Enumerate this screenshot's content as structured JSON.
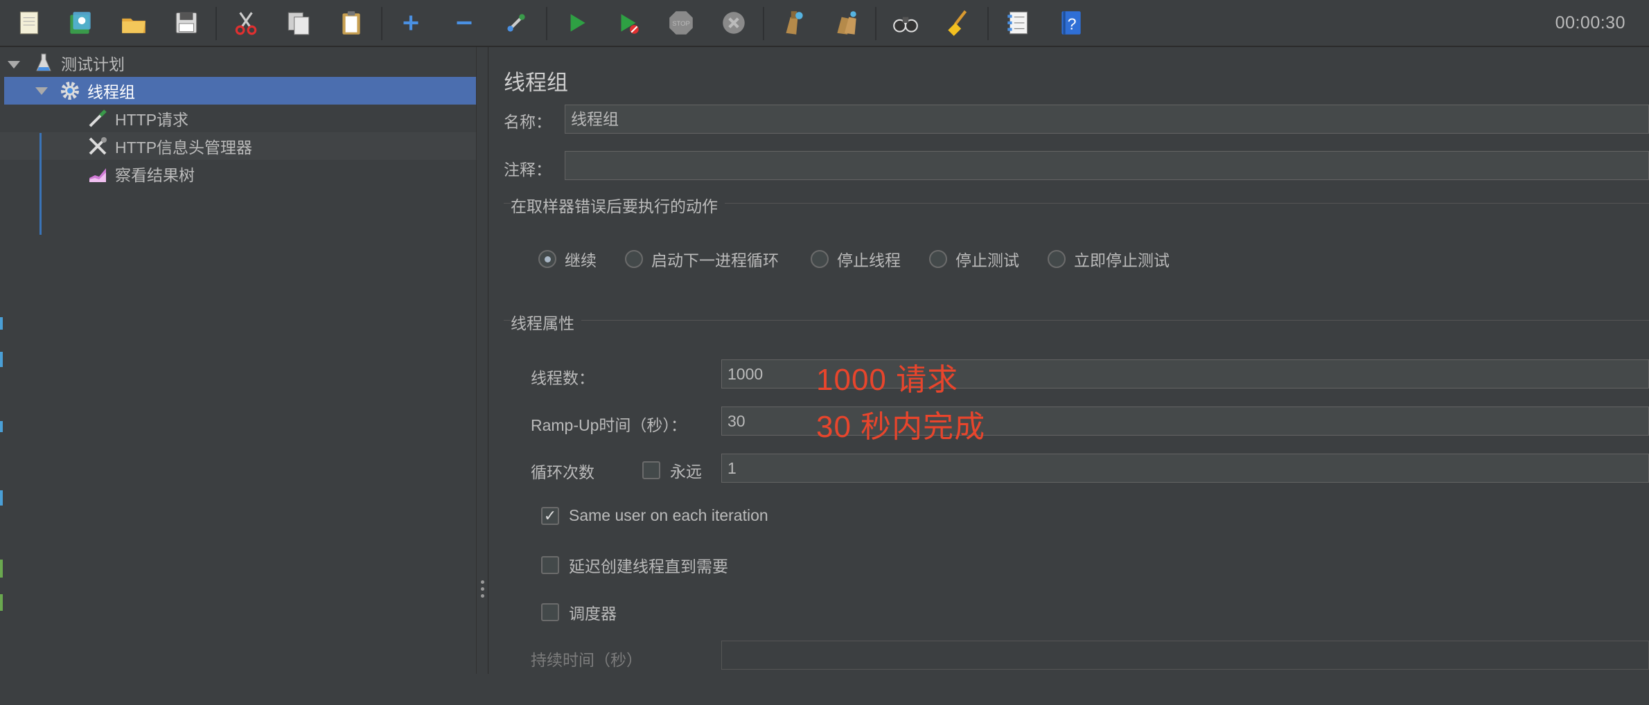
{
  "toolbar": {
    "buttons": [
      "new-icon",
      "templates-icon",
      "open-icon",
      "save-icon",
      "cut-icon",
      "copy-icon",
      "paste-icon",
      "expand-icon",
      "collapse-icon",
      "toggle-icon",
      "start-icon",
      "start-no-pauses-icon",
      "stop-icon",
      "shutdown-icon",
      "clear-icon",
      "clear-all-icon",
      "search-icon",
      "reset-search-icon",
      "function-helper-icon",
      "help-icon"
    ],
    "timer": "00:00:30"
  },
  "tree": {
    "items": [
      {
        "label": "测试计划",
        "icon": "flask-icon"
      },
      {
        "label": "线程组",
        "icon": "gear-icon"
      },
      {
        "label": "HTTP请求",
        "icon": "pipette-icon"
      },
      {
        "label": "HTTP信息头管理器",
        "icon": "tools-icon"
      },
      {
        "label": "察看结果树",
        "icon": "chart-icon"
      }
    ]
  },
  "panel": {
    "title": "线程组",
    "name_label": "名称：",
    "name_value": "线程组",
    "comment_label": "注释：",
    "comment_value": "",
    "error_group_title": "在取样器错误后要执行的动作",
    "error_actions": [
      "继续",
      "启动下一进程循环",
      "停止线程",
      "停止测试",
      "立即停止测试"
    ],
    "error_selected": "继续",
    "thread_group_title": "线程属性",
    "threads_label": "线程数：",
    "threads_value": "1000",
    "threads_note": "1000 请求",
    "rampup_label": "Ramp-Up时间（秒）：",
    "rampup_value": "30",
    "rampup_note": "30 秒内完成",
    "loop_label": "循环次数",
    "forever_label": "永远",
    "forever_checked": false,
    "loop_value": "1",
    "same_user_label": "Same user on each iteration",
    "same_user_checked": true,
    "delay_label": "延迟创建线程直到需要",
    "delay_checked": false,
    "scheduler_label": "调度器",
    "scheduler_checked": false,
    "duration_label": "持续时间（秒）",
    "duration_value": ""
  },
  "colors": {
    "background": "#3c3f41",
    "selection": "#4b6eaf",
    "annotation": "#e8452c"
  }
}
